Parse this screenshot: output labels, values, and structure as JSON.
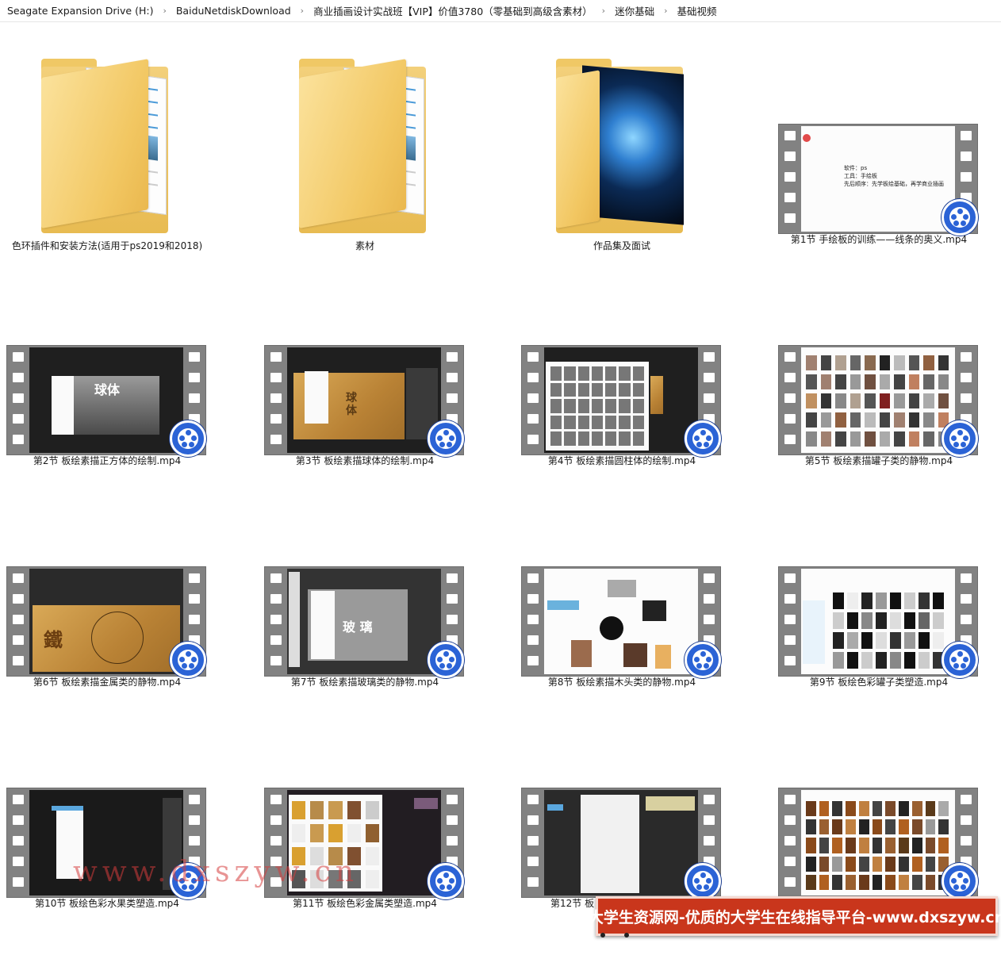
{
  "breadcrumb": [
    "Seagate Expansion Drive (H:)",
    "BaiduNetdiskDownload",
    "商业插画设计实战班【VIP】价值3780（零基础到高级含素材）",
    "迷你基础",
    "基础视频"
  ],
  "items": [
    {
      "label": "色环插件和安装方法(适用于ps2019和2018)",
      "type": "folder",
      "icon": "folder-icon"
    },
    {
      "label": "素材",
      "type": "folder",
      "icon": "folder-icon"
    },
    {
      "label": "作品集及面试",
      "type": "folder",
      "icon": "folder-icon"
    },
    {
      "label": "第1节 手绘板的训练——线条的奥义.mp4",
      "type": "video",
      "icon": "video-file-icon"
    },
    {
      "label": "第2节 板绘素描正方体的绘制.mp4",
      "type": "video",
      "icon": "video-file-icon"
    },
    {
      "label": "第3节 板绘素描球体的绘制.mp4",
      "type": "video",
      "icon": "video-file-icon"
    },
    {
      "label": "第4节 板绘素描圆柱体的绘制.mp4",
      "type": "video",
      "icon": "video-file-icon"
    },
    {
      "label": "第5节 板绘素描罐子类的静物.mp4",
      "type": "video",
      "icon": "video-file-icon"
    },
    {
      "label": "第6节 板绘素描金属类的静物.mp4",
      "type": "video",
      "icon": "video-file-icon"
    },
    {
      "label": "第7节 板绘素描玻璃类的静物.mp4",
      "type": "video",
      "icon": "video-file-icon"
    },
    {
      "label": "第8节 板绘素描木头类的静物.mp4",
      "type": "video",
      "icon": "video-file-icon"
    },
    {
      "label": "第9节 板绘色彩罐子类塑造.mp4",
      "type": "video",
      "icon": "video-file-icon"
    },
    {
      "label": "第10节 板绘色彩水果类塑造.mp4",
      "type": "video",
      "icon": "video-file-icon"
    },
    {
      "label": "第11节 板绘色彩金属类塑造.mp4",
      "type": "video",
      "icon": "video-file-icon"
    },
    {
      "label": "第12节 板",
      "type": "video",
      "icon": "video-file-icon"
    },
    {
      "label": "",
      "type": "video",
      "icon": "video-file-icon"
    }
  ],
  "thumbs": {
    "t1_lines": [
      "软件：ps",
      "工具：手绘板",
      "先后顺序：先学板绘基础，再学商业插画"
    ],
    "t2_text": "球体",
    "t3_text": "球\n体",
    "t6_text": "鐵",
    "t7_text": "玻 璃"
  },
  "watermark": "www.dxszyw.cn",
  "banner": "大学生资源网-优质的大学生在线指导平台-www.dxszyw.cn",
  "colors": {
    "badge": "#2b63d6",
    "banner": "#c9361c",
    "folder": "#f2c762"
  }
}
